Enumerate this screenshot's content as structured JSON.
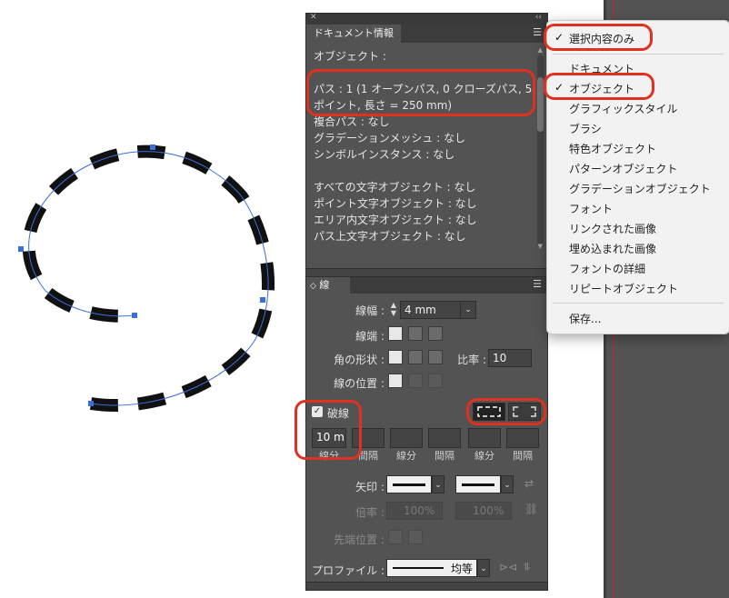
{
  "doc_info_panel": {
    "tab_title": "ドキュメント情報",
    "lines": [
      "オブジェクト :",
      "",
      "パス : 1 (1 オープンパス, 0 クローズパス, 5",
      "ポイント, 長さ = 250 mm)",
      "複合パス : なし",
      "グラデーションメッシュ : なし",
      "シンボルインスタンス : なし",
      "",
      "すべての文字オブジェクト : なし",
      "ポイント文字オブジェクト : なし",
      "エリア内文字オブジェクト : なし",
      "パス上文字オブジェクト : なし"
    ]
  },
  "stroke_panel": {
    "tab_title": "線",
    "weight_label": "線幅 :",
    "weight_value": "4 mm",
    "cap_label": "線端 :",
    "corner_label": "角の形状 :",
    "miter_label": "比率 :",
    "miter_value": "10",
    "align_label": "線の位置 :",
    "dashed_label": "破線",
    "dashed_checked": true,
    "dash_values": [
      "10 m",
      "",
      "",
      "",
      "",
      ""
    ],
    "dash_labels": [
      "線分",
      "間隔",
      "線分",
      "間隔",
      "線分",
      "間隔"
    ],
    "arrow_label": "矢印 :",
    "scale_label": "倍率 :",
    "scale_start": "100%",
    "scale_end": "100%",
    "align_arrow_label": "先端位置 :",
    "profile_label": "プロファイル :",
    "profile_value": "均等"
  },
  "panel_menu": {
    "items": [
      {
        "label": "選択内容のみ",
        "checked": true
      },
      {
        "label": "ドキュメント",
        "checked": false
      },
      {
        "label": "オブジェクト",
        "checked": true
      },
      {
        "label": "グラフィックスタイル",
        "checked": false
      },
      {
        "label": "ブラシ",
        "checked": false
      },
      {
        "label": "特色オブジェクト",
        "checked": false
      },
      {
        "label": "パターンオブジェクト",
        "checked": false
      },
      {
        "label": "グラデーションオブジェクト",
        "checked": false
      },
      {
        "label": "フォント",
        "checked": false
      },
      {
        "label": "リンクされた画像",
        "checked": false
      },
      {
        "label": "埋め込まれた画像",
        "checked": false
      },
      {
        "label": "フォントの詳細",
        "checked": false
      },
      {
        "label": "リピートオブジェクト",
        "checked": false
      },
      {
        "label": "保存...",
        "checked": false
      }
    ]
  },
  "icons": {
    "close": "close-icon",
    "collapse": "double-chevron-icon",
    "panel_menu": "hamburger-icon",
    "checkmark": "checkmark-icon"
  },
  "colors": {
    "highlight": "#e03020",
    "selection_blue": "#3a6fd8",
    "panel_bg": "#535353"
  }
}
